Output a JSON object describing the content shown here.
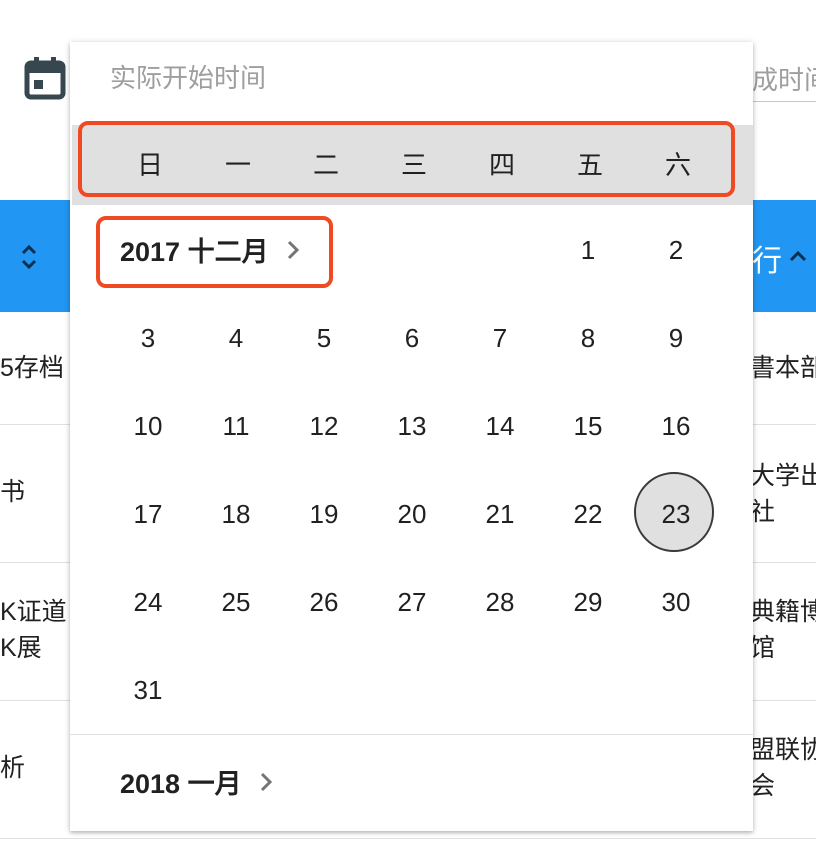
{
  "start_input": {
    "placeholder": "实际开始时间"
  },
  "end_input": {
    "placeholder_fragment": "成时间"
  },
  "table": {
    "header_right_fragment": "行",
    "rows": [
      {
        "left": [
          "5存档"
        ],
        "right": [
          "書本部"
        ]
      },
      {
        "left": [
          "书"
        ],
        "right": [
          "大学出",
          "社"
        ]
      },
      {
        "left": [
          "K证道",
          "K展"
        ],
        "right": [
          "典籍博",
          "馆"
        ]
      },
      {
        "left": [
          "析"
        ],
        "right": [
          "盟联协",
          "会"
        ]
      }
    ]
  },
  "weekdays": [
    "日",
    "一",
    "二",
    "三",
    "四",
    "五",
    "六"
  ],
  "current_month": {
    "label": "2017 十二月",
    "days": [
      "1",
      "2",
      "3",
      "4",
      "5",
      "6",
      "7",
      "8",
      "9",
      "10",
      "11",
      "12",
      "13",
      "14",
      "15",
      "16",
      "17",
      "18",
      "19",
      "20",
      "21",
      "22",
      "23",
      "24",
      "25",
      "26",
      "27",
      "28",
      "29",
      "30",
      "31"
    ],
    "selected_day": "23"
  },
  "next_month": {
    "label": "2018 一月"
  },
  "colors": {
    "accent_blue": "#2196f3",
    "highlight_red": "#f04a24",
    "weekday_bar": "#e0e0e0"
  },
  "icons": {
    "calendar": "calendar-icon",
    "sort": "sort-icon",
    "sort_asc": "sort-up-icon",
    "chevron": "chevron-right-icon"
  }
}
